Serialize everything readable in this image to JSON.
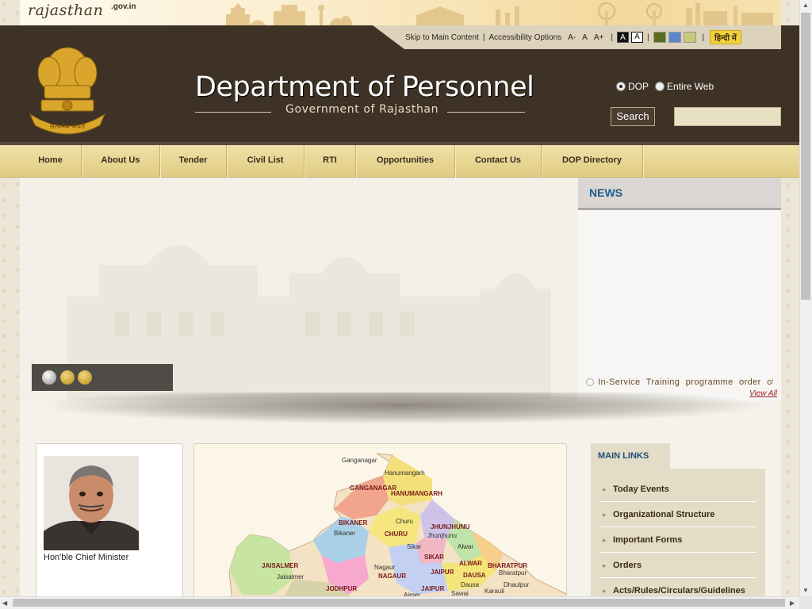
{
  "portal": {
    "logo_text": "rajasthan",
    "logo_domain": ".gov.in"
  },
  "utility": {
    "skip": "Skip to Main Content",
    "accessibility": "Accessibility Options",
    "font_small": "A-",
    "font_normal": "A",
    "font_large": "A+",
    "contrast_dark": "A",
    "contrast_light": "A",
    "theme_colors": [
      "#5c6b1c",
      "#5b86c9",
      "#c9c97a"
    ],
    "hindi": "हिन्दी में"
  },
  "header": {
    "title": "Department of Personnel",
    "subtitle": "Government of Rajasthan",
    "emblem_motto": "सत्यमेव जयते"
  },
  "search": {
    "option_dop": "DOP",
    "option_web": "Entire Web",
    "selected": "DOP",
    "button": "Search",
    "value": ""
  },
  "nav": {
    "items": [
      "Home",
      "About Us",
      "Tender",
      "Civil List",
      "RTI",
      "Opportunities",
      "Contact Us",
      "DOP Directory"
    ]
  },
  "news": {
    "heading": "NEWS",
    "items": [
      "In-Service Training programme order of"
    ],
    "view_all": "View All"
  },
  "cm": {
    "caption": "Hon'ble Chief Minister"
  },
  "map": {
    "labels": [
      {
        "text": "Ganganagar",
        "cap": false
      },
      {
        "text": "Hanumangarh",
        "cap": false
      },
      {
        "text": "GANGANAGAR",
        "cap": true
      },
      {
        "text": "HANUMANGARH",
        "cap": true
      },
      {
        "text": "BIKANER",
        "cap": true
      },
      {
        "text": "Churu",
        "cap": false
      },
      {
        "text": "JHUNJHUNU",
        "cap": true
      },
      {
        "text": "Jhunjhunu",
        "cap": false
      },
      {
        "text": "Bikaner",
        "cap": false
      },
      {
        "text": "CHURU",
        "cap": true
      },
      {
        "text": "Sikar",
        "cap": false
      },
      {
        "text": "Alwar",
        "cap": false
      },
      {
        "text": "SIKAR",
        "cap": true
      },
      {
        "text": "ALWAR",
        "cap": true
      },
      {
        "text": "BHARATPUR",
        "cap": true
      },
      {
        "text": "JAISALMER",
        "cap": true
      },
      {
        "text": "Nagaur",
        "cap": false
      },
      {
        "text": "JAIPUR",
        "cap": true
      },
      {
        "text": "DAUSA",
        "cap": true
      },
      {
        "text": "Bharatpur",
        "cap": false
      },
      {
        "text": "Jaisalmer",
        "cap": false
      },
      {
        "text": "NAGAUR",
        "cap": true
      },
      {
        "text": "Dausa",
        "cap": false
      },
      {
        "text": "Dhaulpur",
        "cap": false
      },
      {
        "text": "JODHPUR",
        "cap": true
      },
      {
        "text": "JAIPUR",
        "cap": true
      },
      {
        "text": "Sawai",
        "cap": false
      },
      {
        "text": "Karauli",
        "cap": false
      },
      {
        "text": "Ajmer",
        "cap": false
      }
    ]
  },
  "main_links": {
    "heading": "MAIN LINKS",
    "items": [
      "Today Events",
      "Organizational Structure",
      "Important Forms",
      "Orders",
      "Acts/Rules/Circulars/Guidelines"
    ]
  },
  "slider": {
    "dot_count": 3,
    "active_index": 0
  }
}
